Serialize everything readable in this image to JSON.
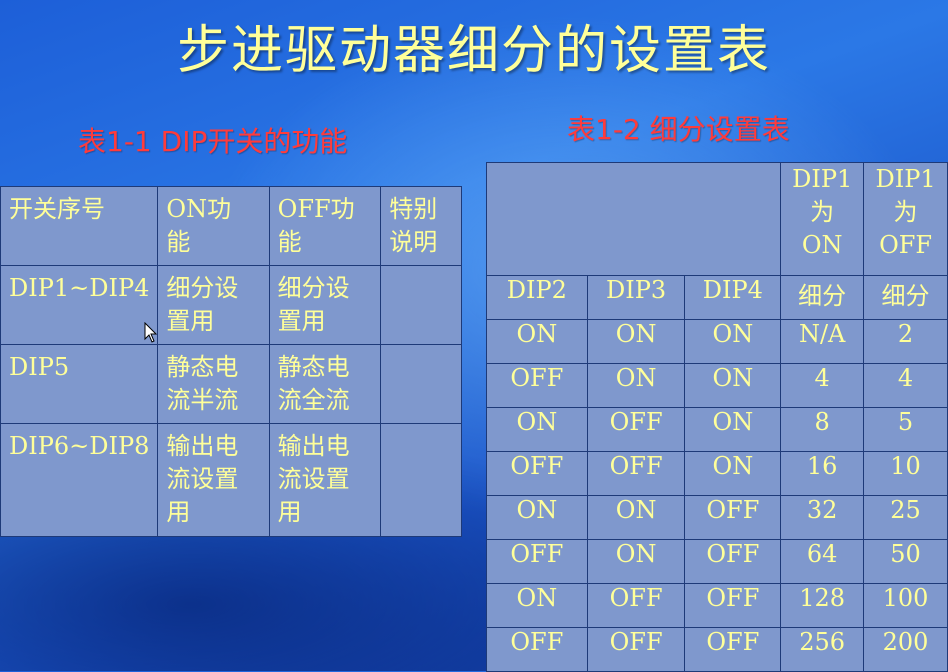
{
  "title": "步进驱动器细分的设置表",
  "left_table": {
    "caption": "表1-1   DIP开关的功能",
    "headers": [
      [
        "开关序号"
      ],
      [
        "ON功",
        "能"
      ],
      [
        "OFF功",
        "能"
      ],
      [
        "特别",
        "说明"
      ]
    ],
    "rows": [
      {
        "switch": "DIP1~DIP4",
        "on": [
          "细分设",
          "置用"
        ],
        "off": [
          "细分设",
          "置用"
        ],
        "note": ""
      },
      {
        "switch": "DIP5",
        "on": [
          "静态电",
          "流半流"
        ],
        "off": [
          "静态电",
          "流全流"
        ],
        "note": ""
      },
      {
        "switch": "DIP6~DIP8",
        "on": [
          "输出电",
          "流设置",
          "用"
        ],
        "off": [
          "输出电",
          "流设置",
          "用"
        ],
        "note": ""
      }
    ]
  },
  "right_table": {
    "caption": "表1-2  细分设置表",
    "dip1_on_header": [
      "DIP1",
      "为",
      "ON"
    ],
    "dip1_off_header": [
      "DIP1",
      "为",
      "OFF"
    ],
    "column_headers": [
      "DIP2",
      "DIP3",
      "DIP4",
      "细分",
      "细分"
    ],
    "rows": [
      [
        "ON",
        "ON",
        "ON",
        "N/A",
        "2"
      ],
      [
        "OFF",
        "ON",
        "ON",
        "4",
        "4"
      ],
      [
        "ON",
        "OFF",
        "ON",
        "8",
        "5"
      ],
      [
        "OFF",
        "OFF",
        "ON",
        "16",
        "10"
      ],
      [
        "ON",
        "ON",
        "OFF",
        "32",
        "25"
      ],
      [
        "OFF",
        "ON",
        "OFF",
        "64",
        "50"
      ],
      [
        "ON",
        "OFF",
        "OFF",
        "128",
        "100"
      ],
      [
        "OFF",
        "OFF",
        "OFF",
        "256",
        "200"
      ]
    ]
  },
  "colors": {
    "title": "#ffff99",
    "caption": "#ff3b3b",
    "table_fill": "#7f98cd",
    "table_border": "#1e3a78",
    "table_text": "#ffff99"
  },
  "icons": {
    "mouse_cursor": "mouse-pointer-icon"
  }
}
